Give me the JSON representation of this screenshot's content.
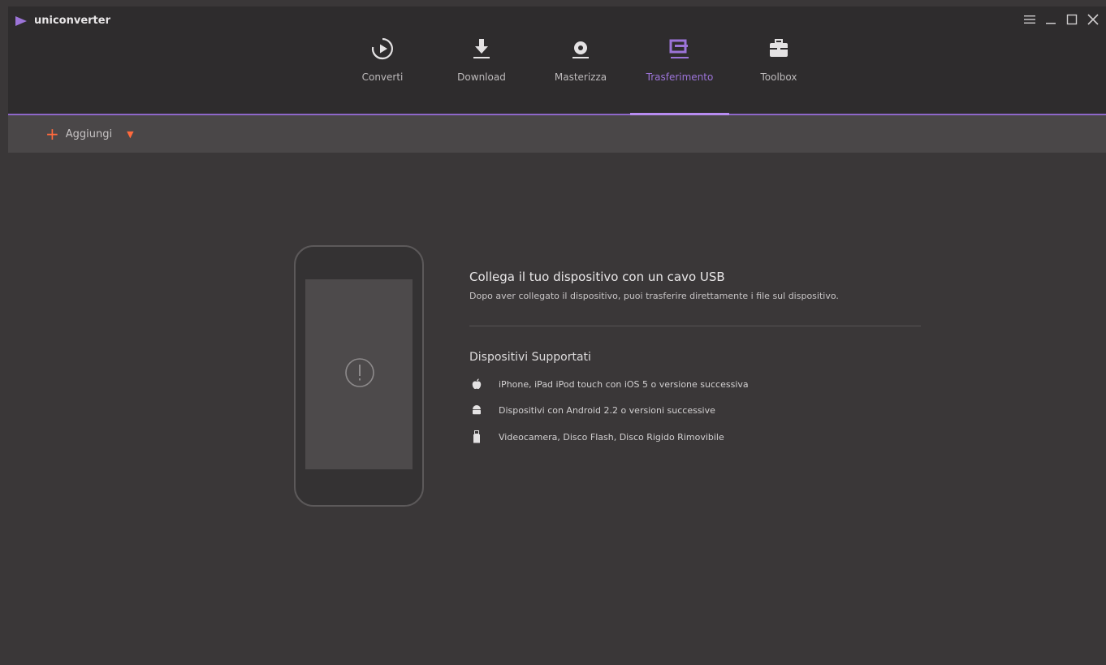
{
  "app": {
    "title": "uniconverter"
  },
  "tabs": [
    {
      "label": "Converti"
    },
    {
      "label": "Download"
    },
    {
      "label": "Masterizza"
    },
    {
      "label": "Trasferimento"
    },
    {
      "label": "Toolbox"
    }
  ],
  "active_tab": "Trasferimento",
  "toolbar": {
    "add_label": "Aggiungi"
  },
  "main": {
    "heading": "Collega il tuo dispositivo con un cavo USB",
    "subtext": "Dopo aver collegato il dispositivo, puoi trasferire direttamente i file sul dispositivo.",
    "supported_title": "Dispositivi Supportati",
    "devices": [
      {
        "icon": "apple-icon",
        "text": "iPhone, iPad iPod touch con iOS 5 o versione successiva"
      },
      {
        "icon": "android-icon",
        "text": "Dispositivi con Android 2.2 o versioni successive"
      },
      {
        "icon": "usb-drive-icon",
        "text": "Videocamera, Disco Flash, Disco Rigido Rimovibile"
      }
    ]
  },
  "colors": {
    "accent": "#9c74d8",
    "add": "#ff6a3d",
    "background": "#3a3738",
    "titlebar": "#2e2c2d",
    "toolbar": "#4a4748"
  }
}
